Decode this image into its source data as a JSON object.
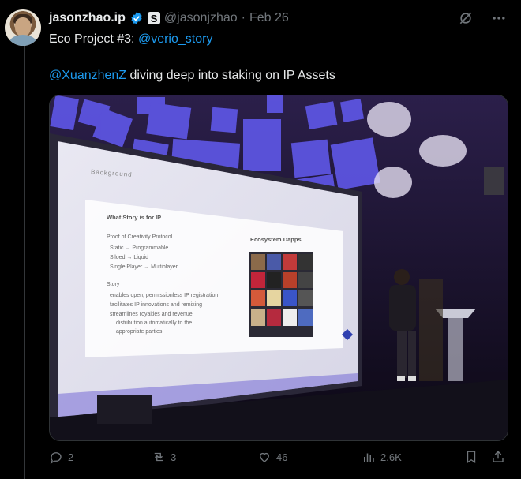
{
  "author": {
    "display_name": "jasonzhao.ip",
    "badge_letter": "S",
    "handle": "@jasonjzhao",
    "separator": "·",
    "date": "Feb 26"
  },
  "tweet": {
    "line1_prefix": "Eco Project #3: ",
    "line1_mention": "@verio_story",
    "line2_mention": "@XuanzhenZ",
    "line2_text": " diving deep into staking on IP Assets"
  },
  "slide": {
    "heading": "Background",
    "card_title": "What Story is for IP",
    "proto_title": "Proof of Creativity Protocol",
    "bullets": [
      "Static → Programmable",
      "Siloed → Liquid",
      "Single Player → Multiplayer"
    ],
    "story_label": "Story",
    "story_bullets": [
      "enables open, permissionless IP registration",
      "facilitates IP innovations and remixing",
      "streamlines royalties and revenue",
      "distribution automatically to the",
      "appropriate parties"
    ],
    "dapps_title": "Ecosystem Dapps"
  },
  "actions": {
    "replies": "2",
    "reposts": "3",
    "likes": "46",
    "views": "2.6K"
  },
  "colors": {
    "link": "#1d9bf0",
    "muted": "#71767b",
    "verified": "#1d9bf0"
  }
}
